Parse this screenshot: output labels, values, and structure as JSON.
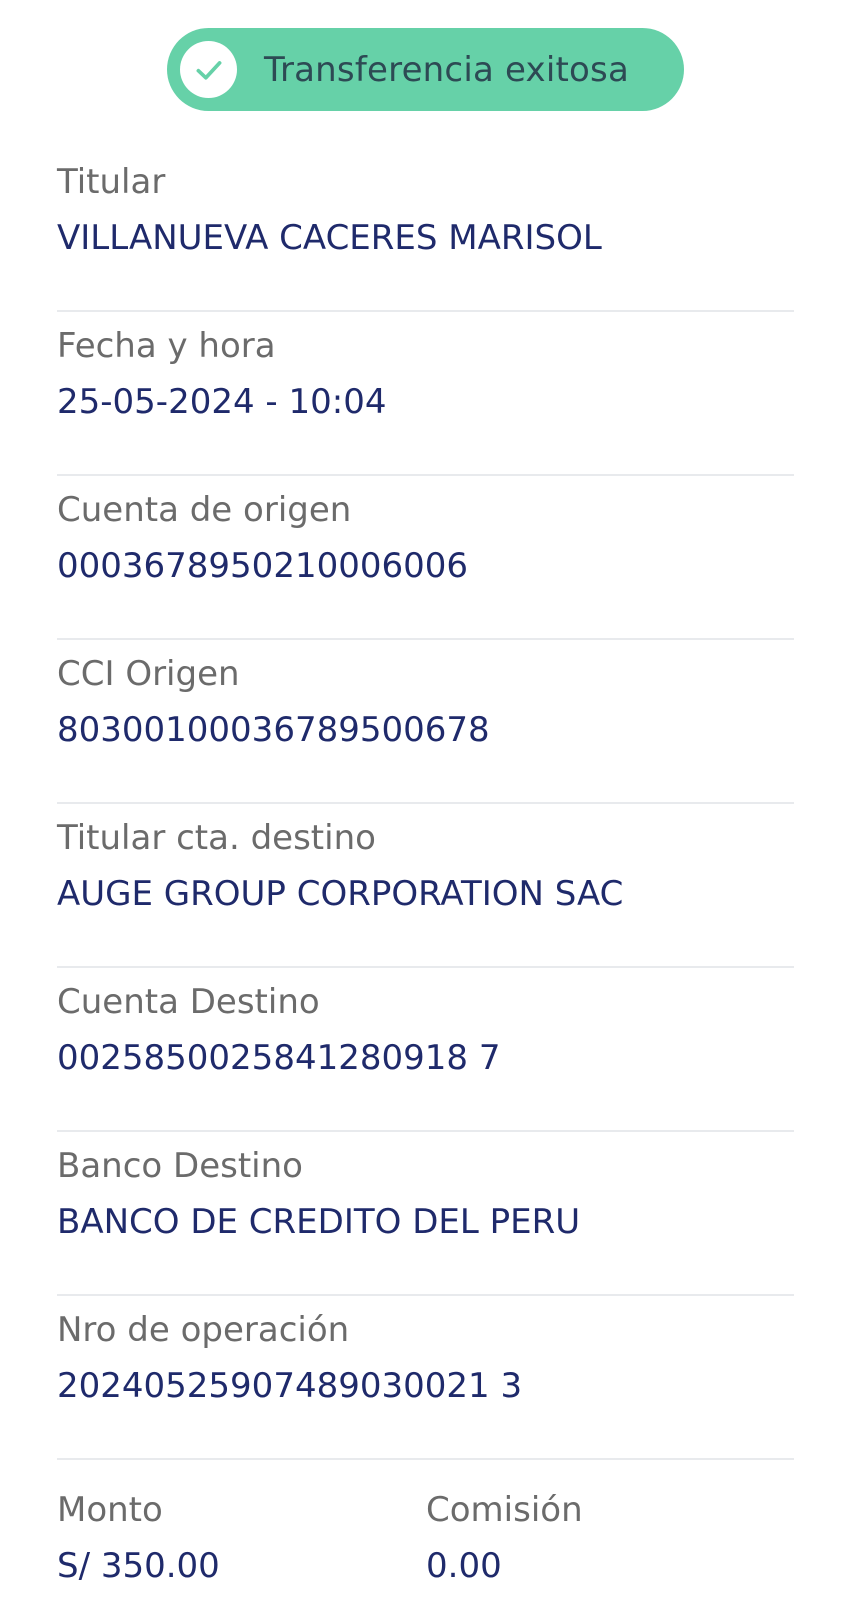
{
  "status": {
    "icon": "check-icon",
    "label": "Transferencia exitosa",
    "color": "#66d1a8"
  },
  "details": [
    {
      "label": "Titular",
      "value": "VILLANUEVA CACERES MARISOL"
    },
    {
      "label": "Fecha y hora",
      "value": "25-05-2024 - 10:04"
    },
    {
      "label": "Cuenta de origen",
      "value": "0003678950210006006"
    },
    {
      "label": "CCI Origen",
      "value": "80300100036789500678"
    },
    {
      "label": "Titular cta. destino",
      "value": "AUGE GROUP CORPORATION SAC"
    },
    {
      "label": "Cuenta Destino",
      "value": "0025850025841280918 7"
    },
    {
      "label": "Banco Destino",
      "value": "BANCO DE CREDITO DEL PERU"
    },
    {
      "label": "Nro de operación",
      "value": "20240525907489030021 3"
    }
  ],
  "amount": {
    "label": "Monto",
    "value": "S/ 350.00"
  },
  "fee": {
    "label": "Comisión",
    "value": "0.00"
  },
  "colors": {
    "label_text": "#6b6b6b",
    "value_text": "#1f2a6b",
    "divider": "#e8eaed"
  }
}
